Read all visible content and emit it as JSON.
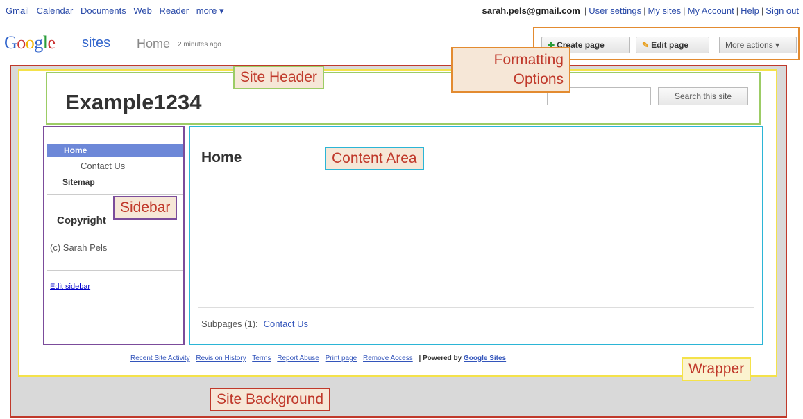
{
  "top_nav": {
    "links": [
      "Gmail",
      "Calendar",
      "Documents",
      "Web",
      "Reader",
      "more ▾"
    ],
    "user_email": "sarah.pels@gmail.com",
    "account_links": [
      "User settings",
      "My sites",
      "My Account",
      "Help",
      "Sign out"
    ]
  },
  "branding": {
    "logo_letters": [
      "G",
      "o",
      "o",
      "g",
      "l",
      "e"
    ],
    "product": "sites",
    "page_name": "Home",
    "last_edited": "2 minutes ago"
  },
  "actions": {
    "create_page": "Create page",
    "edit_page": "Edit page",
    "more_actions": "More actions ▾"
  },
  "site": {
    "title": "Example1234",
    "search_button": "Search this site",
    "sidebar": {
      "nav_home": "Home",
      "nav_contact": "Contact Us",
      "nav_sitemap": "Sitemap",
      "copyright_title": "Copyright",
      "copyright_text": "(c) Sarah Pels",
      "edit_sidebar": "Edit sidebar"
    },
    "content": {
      "page_title": "Home",
      "subpages_label": "Subpages (1):",
      "subpages_link": "Contact Us"
    },
    "footer": {
      "links": [
        "Recent Site Activity",
        "Revision History",
        "Terms",
        "Report Abuse",
        "Print page",
        "Remove Access"
      ],
      "powered_prefix": "| Powered by",
      "powered_link": "Google Sites"
    }
  },
  "callouts": {
    "site_header": "Site Header",
    "formatting_line1": "Formatting",
    "formatting_line2": "Options",
    "content_area": "Content Area",
    "sidebar": "Sidebar",
    "wrapper": "Wrapper",
    "site_background": "Site Background"
  },
  "colors": {
    "site_header_box": "#9ccc65",
    "formatting_box": "#e38b30",
    "content_box": "#2bb5d6",
    "sidebar_box": "#7b4c9b",
    "wrapper_box": "#f4e24a",
    "background_box": "#c0392b",
    "nav_selected": "#6d88d8"
  }
}
